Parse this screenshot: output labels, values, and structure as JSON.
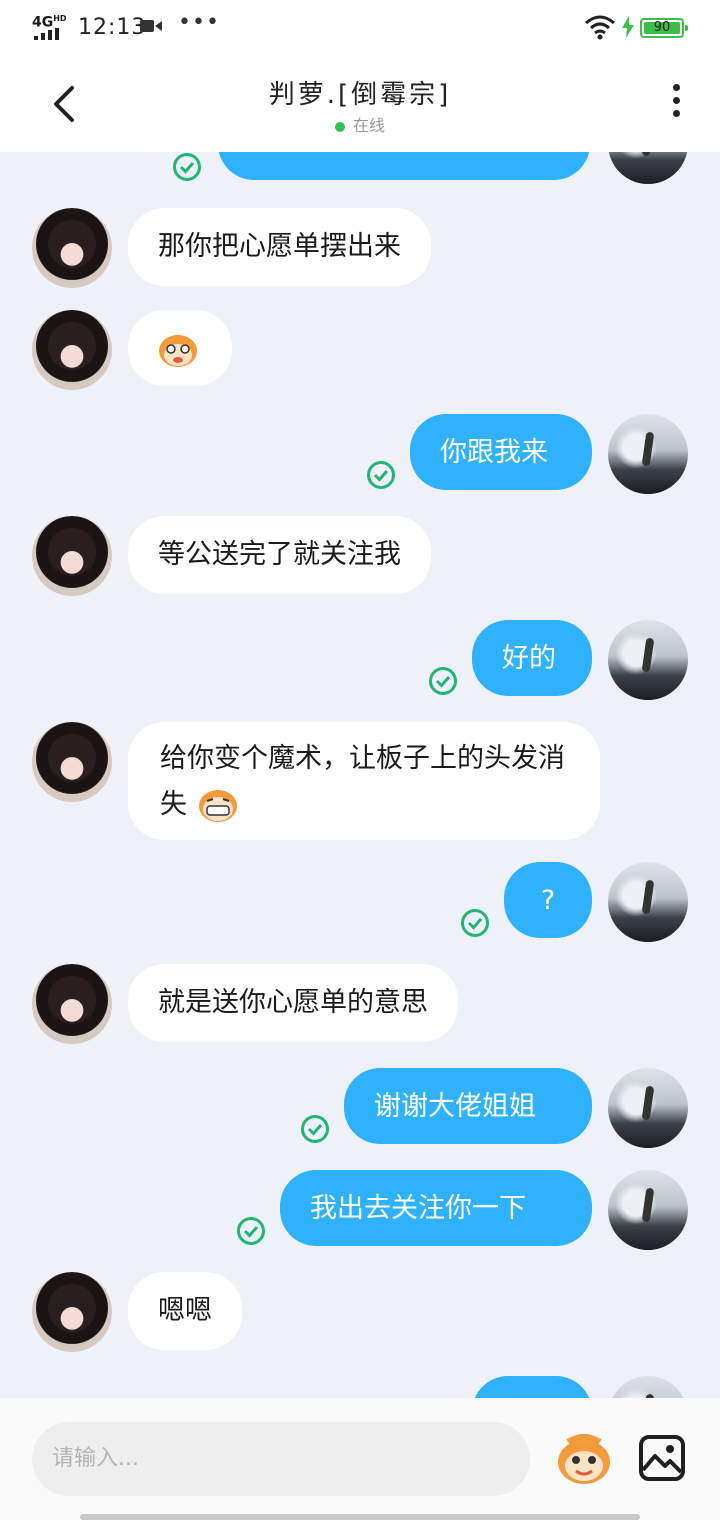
{
  "status_bar": {
    "network": "4G",
    "network_sup": "HD",
    "time": "12:13",
    "battery": "90"
  },
  "header": {
    "title": "判萝.[倒霉宗]",
    "status": "在线"
  },
  "messages": [
    {
      "side": "out",
      "text": ""
    },
    {
      "side": "in",
      "text": "那你把心愿单摆出来"
    },
    {
      "side": "in",
      "text": ""
    },
    {
      "side": "out",
      "text": "你跟我来"
    },
    {
      "side": "in",
      "text": "等公送完了就关注我"
    },
    {
      "side": "out",
      "text": "好的"
    },
    {
      "side": "in",
      "text": "给你变个魔术，让板子上的头发消失"
    },
    {
      "side": "out",
      "text": "?"
    },
    {
      "side": "in",
      "text": "就是送你心愿单的意思"
    },
    {
      "side": "out",
      "text": "谢谢大佬姐姐"
    },
    {
      "side": "out",
      "text": "我出去关注你一下"
    },
    {
      "side": "in",
      "text": "嗯嗯"
    }
  ],
  "input": {
    "placeholder": "请输入..."
  },
  "colors": {
    "bubble_out": "#2fb1fb",
    "bubble_in": "#ffffff",
    "check": "#22b573",
    "online": "#31c35a",
    "background": "#eef1f7"
  },
  "icons": [
    "back-arrow-icon",
    "more-icon",
    "read-check-icon",
    "emoji-icon",
    "image-icon",
    "wifi-icon",
    "charging-icon",
    "camera-icon"
  ]
}
